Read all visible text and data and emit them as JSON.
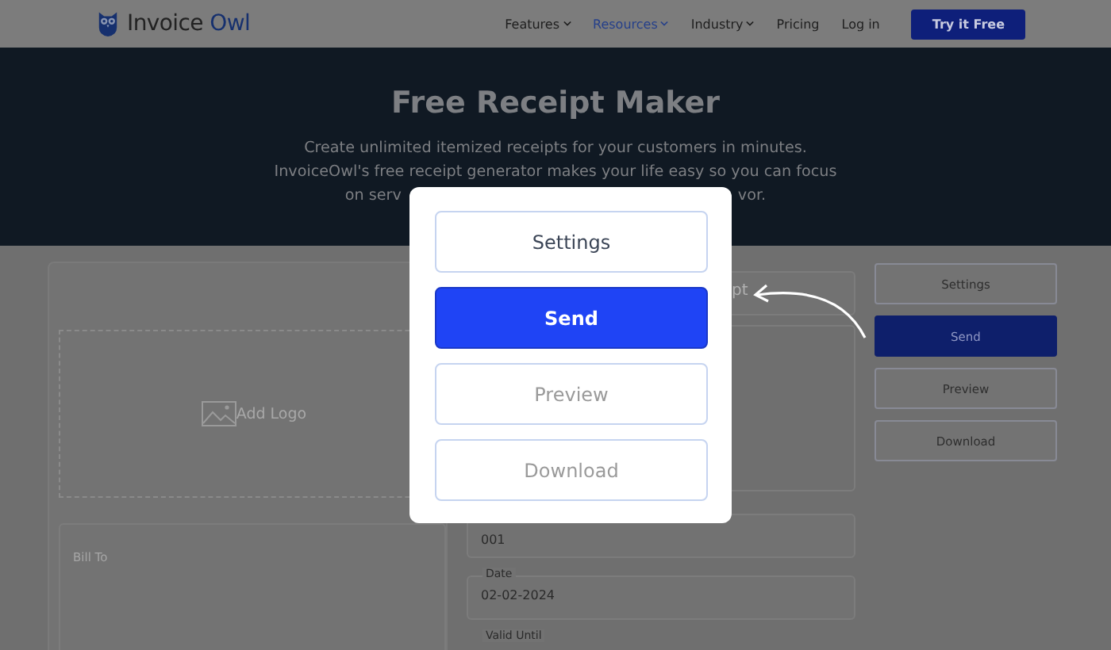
{
  "navbar": {
    "logo": {
      "text": "Invoice ",
      "accent": "Owl"
    },
    "links": [
      {
        "label": "Features",
        "dropdown": true,
        "selected": false
      },
      {
        "label": "Resources",
        "dropdown": true,
        "selected": true
      },
      {
        "label": "Industry",
        "dropdown": true,
        "selected": false
      },
      {
        "label": "Pricing",
        "dropdown": false,
        "selected": false
      },
      {
        "label": "Log in",
        "dropdown": false,
        "selected": false
      }
    ],
    "cta": "Try it Free"
  },
  "hero": {
    "title": "Free Receipt Maker",
    "lines": [
      "Create unlimited itemized receipts for your customers in minutes.",
      "InvoiceOwl's free receipt generator makes your life easy so you can focus"
    ],
    "line_3_left": "on serv",
    "line_3_right": "vor."
  },
  "form": {
    "logo_upload": "Add Logo",
    "bill_to": "Bill To",
    "fields": [
      {
        "kind": "field",
        "value": "pt"
      },
      {
        "kind": "area"
      },
      {
        "kind": "field",
        "value": "001"
      },
      {
        "kind": "labeled",
        "label": "Date",
        "value": "02-02-2024"
      },
      {
        "kind": "label",
        "label": "Valid Until"
      }
    ]
  },
  "actions": [
    {
      "label": "Settings",
      "selected": false
    },
    {
      "label": "Send",
      "selected": true
    },
    {
      "label": "Preview",
      "selected": false
    },
    {
      "label": "Download",
      "selected": false
    }
  ],
  "popup": {
    "buttons": [
      {
        "label": "Settings",
        "selected": false,
        "disabled": false
      },
      {
        "label": "Send",
        "selected": true,
        "disabled": false
      },
      {
        "label": "Preview",
        "selected": false,
        "disabled": true
      },
      {
        "label": "Download",
        "selected": false,
        "disabled": true
      }
    ]
  }
}
